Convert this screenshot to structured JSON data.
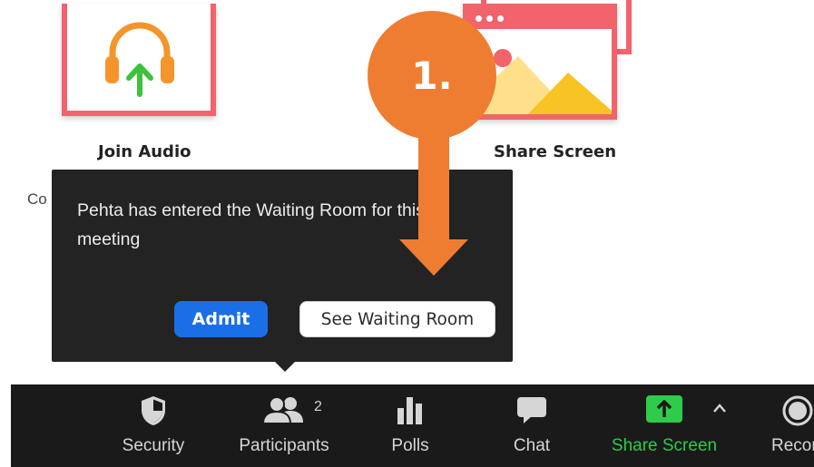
{
  "tiles": {
    "join_audio_label": "Join Audio",
    "share_screen_label": "Share Screen",
    "cut_text": "Co"
  },
  "callout": {
    "label": "1."
  },
  "notification": {
    "message": "Pehta has entered the Waiting Room for this meeting",
    "admit_label": "Admit",
    "see_waiting_room_label": "See Waiting Room"
  },
  "toolbar": {
    "items": [
      {
        "label": "Security",
        "icon": "shield-icon"
      },
      {
        "label": "Participants",
        "icon": "participants-icon",
        "count": "2"
      },
      {
        "label": "Polls",
        "icon": "bar-chart-icon"
      },
      {
        "label": "Chat",
        "icon": "chat-bubble-icon"
      },
      {
        "label": "Share Screen",
        "icon": "share-screen-icon"
      },
      {
        "label": "Recor",
        "icon": "record-icon"
      }
    ]
  },
  "colors": {
    "tile_border": "#f2636b",
    "callout": "#ee7d32",
    "admit_button": "#1a6fe6",
    "share_green": "#2ecc4a",
    "toolbar_bg": "#1a1a1a",
    "popup_bg": "#232323"
  }
}
